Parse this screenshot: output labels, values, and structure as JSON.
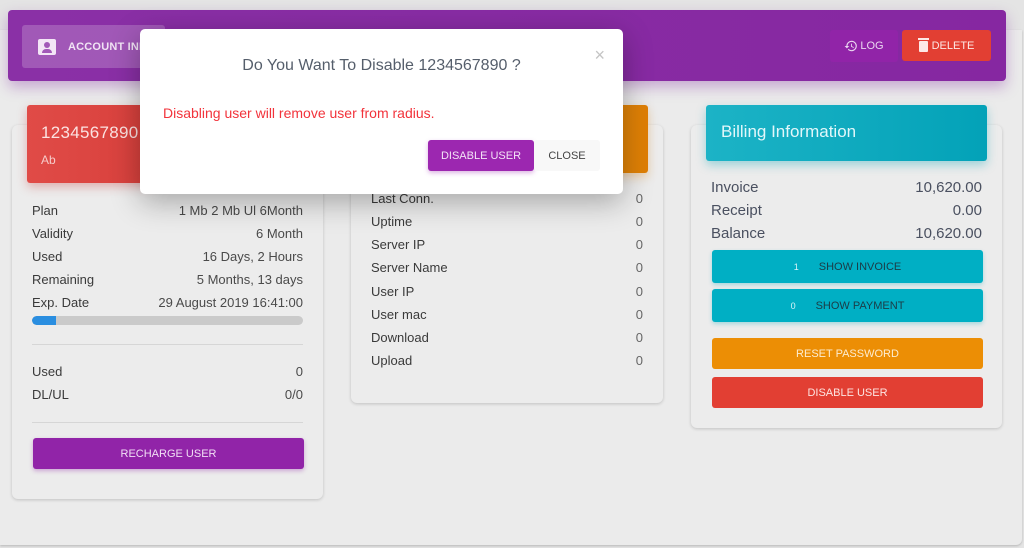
{
  "header": {
    "tab_account_label": "ACCOUNT INFO",
    "log_label": "LOG",
    "delete_label": "DELETE"
  },
  "user_card": {
    "username": "1234567890",
    "subtitle": "Ab",
    "details": [
      {
        "label": "Plan",
        "value": "1 Mb 2 Mb Ul 6Month"
      },
      {
        "label": "Validity",
        "value": "6 Month"
      },
      {
        "label": "Used",
        "value": "16 Days, 2 Hours"
      },
      {
        "label": "Remaining",
        "value": "5 Months, 13 days"
      },
      {
        "label": "Exp. Date",
        "value": "29 August 2019 16:41:00"
      }
    ],
    "validity_progress_percent": 9,
    "usage": [
      {
        "label": "Used",
        "value": "0"
      },
      {
        "label": "DL/UL",
        "value": "0/0"
      }
    ],
    "recharge_label": "RECHARGE USER"
  },
  "session_card": {
    "rows": [
      {
        "label": "Last Conn.",
        "value": "0"
      },
      {
        "label": "Uptime",
        "value": "0"
      },
      {
        "label": "Server IP",
        "value": "0"
      },
      {
        "label": "Server Name",
        "value": "0"
      },
      {
        "label": "User IP",
        "value": "0"
      },
      {
        "label": "User mac",
        "value": "0"
      },
      {
        "label": "Download",
        "value": "0"
      },
      {
        "label": "Upload",
        "value": "0"
      }
    ]
  },
  "billing_card": {
    "title": "Billing Information",
    "rows": [
      {
        "label": "Invoice",
        "value": "10,620.00"
      },
      {
        "label": "Receipt",
        "value": "0.00"
      },
      {
        "label": "Balance",
        "value": "10,620.00"
      }
    ],
    "show_invoice": {
      "count": "1",
      "label": "SHOW INVOICE"
    },
    "show_payment": {
      "count": "0",
      "label": "SHOW PAYMENT"
    },
    "reset_password_label": "RESET PASSWORD",
    "disable_user_label": "DISABLE USER"
  },
  "modal": {
    "title": "Do You Want To Disable 1234567890 ?",
    "close_glyph": "×",
    "message": "Disabling user will remove user from radius.",
    "confirm_label": "DISABLE USER",
    "cancel_label": "CLOSE"
  },
  "colors": {
    "primary_purple": "#9c27b0",
    "danger_red": "#e23f33",
    "warning_orange": "#ec8e05",
    "info_teal": "#00afc4",
    "progress_blue": "#2a8ee0",
    "modal_message_red": "#f2333b"
  }
}
